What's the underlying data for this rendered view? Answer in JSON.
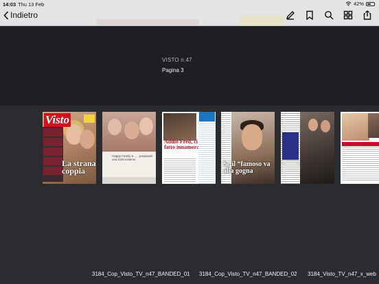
{
  "status_bar": {
    "time": "14:03",
    "date": "Thu 13 Feb",
    "battery": "42%",
    "battery_level": 0.42
  },
  "nav": {
    "back_label": "Indietro",
    "tools": [
      "pencil-icon",
      "bookmark-icon",
      "search-icon",
      "grid-icon",
      "share-icon"
    ]
  },
  "info": {
    "issue": "VISTO n.47",
    "page": "Pagina 3"
  },
  "thumbnails": [
    {
      "title": "La strana coppia",
      "logo": "Visto"
    },
    {
      "title": "Happy Family è... ...preparare una torta insieme."
    },
    {
      "title": "Addio Fred, ci hai fatto innamorare"
    },
    {
      "title": "Se il “famoso va alla gogna"
    },
    {
      "title": ""
    },
    {
      "title": ""
    }
  ],
  "filenames": [
    "3184_Cop_Visto_TV_n47_BANDED_01",
    "3184_Cop_Visto_TV_n47_BANDED_02",
    "3184_Visto_TV_n47_x_web"
  ],
  "colors": {
    "nav_bg": "#ececee",
    "info_bg": "#1d1f22",
    "strip_bg": "#2a2c30",
    "visto_red": "#d3101d"
  }
}
